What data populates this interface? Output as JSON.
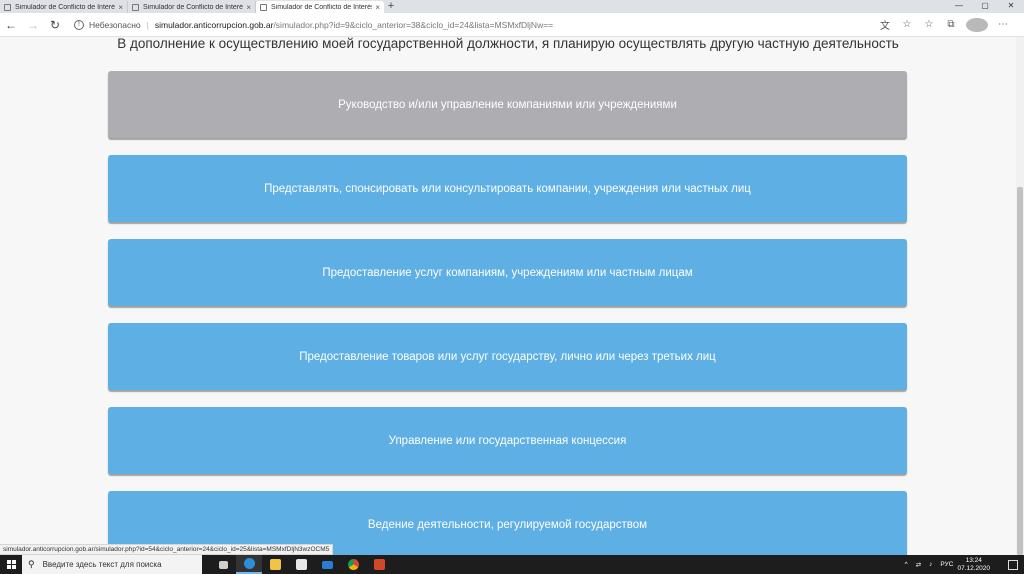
{
  "tabs": [
    {
      "label": "Simulador de Conflicto de Interés",
      "active": false
    },
    {
      "label": "Simulador de Conflicto de Interés",
      "active": false
    },
    {
      "label": "Simulador de Conflicto de Interés",
      "active": true
    }
  ],
  "tab_close_glyph": "×",
  "new_tab_glyph": "+",
  "window_controls": {
    "minimize": "—",
    "maximize": "▢",
    "close": "✕"
  },
  "nav": {
    "back": "←",
    "forward": "→",
    "reload": "↻"
  },
  "address": {
    "warning_glyph": "!",
    "security_label": "Небезопасно",
    "separator": "|",
    "host": "simulador.anticorrupcion.gob.ar",
    "path": "/simulador.php?id=9&ciclo_anterior=38&ciclo_id=24&lista=MSMxfDljNw=="
  },
  "toolbar_icons": {
    "translate": "文",
    "favorite": "☆",
    "collections": "☆",
    "extensions": "⧉",
    "menu": "⋯"
  },
  "page": {
    "question": "В дополнение к осуществлению моей государственной должности, я планирую осуществлять другую частную деятельность",
    "options": [
      {
        "label": "Руководство и/или управление компаниями или учреждениями",
        "state": "selected",
        "color": "#aeadb2"
      },
      {
        "label": "Представлять, спонсировать или консультировать компании, учреждения или частных лиц",
        "state": "default",
        "color": "#5eafe4"
      },
      {
        "label": "Предоставление услуг компаниям, учреждениям или частным лицам",
        "state": "default",
        "color": "#5eafe4"
      },
      {
        "label": "Предоставление товаров или услуг государству, лично или через третьих лиц",
        "state": "default",
        "color": "#5eafe4"
      },
      {
        "label": "Управление или государственная концессия",
        "state": "default",
        "color": "#5eafe4"
      },
      {
        "label": "Ведение деятельности, регулируемой государством",
        "state": "default",
        "color": "#5eafe4"
      }
    ]
  },
  "status_url": "simulador.anticorrupcion.gob.ar/simulador.php?id=54&ciclo_anterior=24&ciclo_id=25&lista=MSMxfDljN3wzOCM5",
  "taskbar": {
    "search_placeholder": "Введите здесь текст для поиска",
    "search_glyph": "⚲",
    "apps": [
      {
        "name": "task-view",
        "color": "#cfcfcf"
      },
      {
        "name": "edge",
        "color": "#2b90d9"
      },
      {
        "name": "file-explorer",
        "color": "#f3c443"
      },
      {
        "name": "store",
        "color": "#e8e8e8"
      },
      {
        "name": "mail",
        "color": "#2b7cd3"
      },
      {
        "name": "chrome",
        "color": "#e0a321"
      },
      {
        "name": "powerpoint",
        "color": "#d24726"
      }
    ],
    "tray": {
      "chevron": "^",
      "network": "⇄",
      "volume": "♪",
      "language": "РУС",
      "time": "13:24",
      "date": "07.12.2020"
    }
  }
}
